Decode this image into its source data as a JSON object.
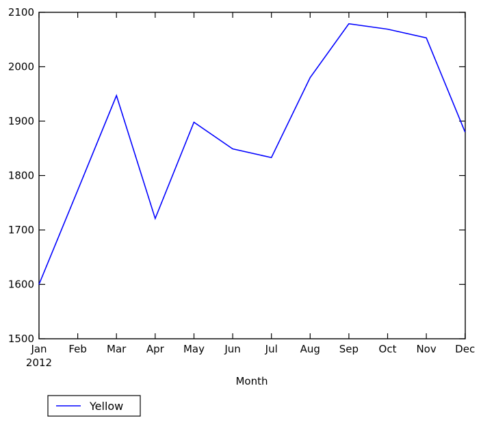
{
  "chart_data": {
    "type": "line",
    "title": "",
    "subtitle": "",
    "xlabel": "Month",
    "ylabel": "",
    "categories": [
      "Jan",
      "Feb",
      "Mar",
      "Apr",
      "May",
      "Jun",
      "Jul",
      "Aug",
      "Sep",
      "Oct",
      "Nov",
      "Dec"
    ],
    "x_year_label": "2012",
    "series": [
      {
        "name": "Yellow",
        "color": "#0000ff",
        "values": [
          1600,
          1773,
          1947,
          1721,
          1898,
          1849,
          1833,
          1980,
          2079,
          2069,
          2053,
          1880
        ]
      }
    ],
    "ylim": [
      1500,
      2100
    ],
    "y_ticks": [
      "1500",
      "1600",
      "1700",
      "1800",
      "1900",
      "2000",
      "2100"
    ],
    "y_tick_values": [
      1500,
      1600,
      1700,
      1800,
      1900,
      2000,
      2100
    ],
    "grid": false,
    "legend_position": "below-left",
    "legend_entries": [
      "Yellow"
    ]
  },
  "axis": {
    "x_title": "Month",
    "year": "2012"
  },
  "legend": {
    "items": [
      {
        "label": "Yellow",
        "color": "#0000ff"
      }
    ]
  },
  "colors": {
    "series": "#0000ff",
    "axis": "#000000",
    "background": "#ffffff"
  }
}
